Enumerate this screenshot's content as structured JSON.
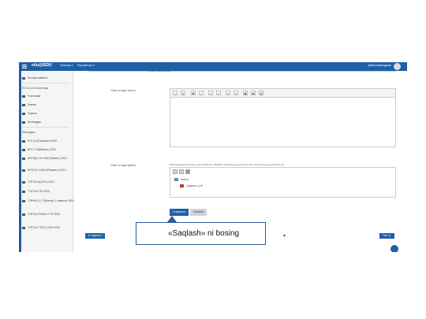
{
  "navbar": {
    "logo": "edu@ISDU",
    "items": [
      "Помощь ▾",
      "Русский (ru) ▾"
    ],
    "user": "Диёра Махмудова"
  },
  "sidebar": {
    "items": [
      "Личный кабинет",
      "ЯТ-Б-5-21-9-ингл.фм",
      "Участники",
      "Значки",
      "Оценки",
      "Календарь",
      "Мои курсы",
      "БТС-С-8(Ташкент) 2020",
      "ВТС-Т-09(Жизнь) 2020",
      "ИНТБ(Б) О1-ИМ-2(Жизнь) 2019",
      "КНТБ-Б-3-ИМ-3(Ташкент) 2019",
      "ТЭТЭ-Б-4(2021) 2020",
      "ТЭТЭ-5-ГТЕ 2020",
      "ТЭРМ-Б-2-ГТ(Жизнь) 2 семестр 2019",
      "ТЭТЭ-Б-ГЕМЭС-ГТЕ 2020",
      "ТЭТЭ-Б-ГТЕ(Т) 2020 2020"
    ]
  },
  "content": {
    "header_text": "Ответ в виде файла",
    "answer_text_label": "Ответ в виде текста",
    "answer_file_label": "Ответ в виде файла",
    "toolbar_buttons": [
      "i",
      "A",
      "B",
      "I",
      "≡",
      "≡",
      "⚭",
      "⚭",
      "▣",
      "▤",
      "▥"
    ],
    "file_note": "Максимальный размер новых файлов: 10Мбайт, максимальное количество прикрепленных файлов: 20",
    "folder_label": "Файлы",
    "file_label": "Задание 1.pdf",
    "save_label": "Сохранить",
    "cancel_label": "Отмена",
    "prev_label": "◄ Задание 2",
    "next_label": "Тест ►",
    "page_mark": "◆"
  },
  "callout": {
    "text": "«Saqlash» ni bosing"
  }
}
